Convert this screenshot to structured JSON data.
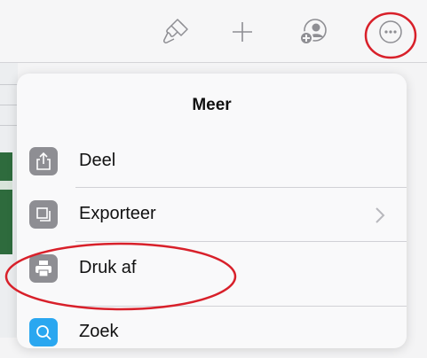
{
  "toolbar": {
    "icons": [
      "paintbrush-icon",
      "plus-icon",
      "add-collaborator-icon",
      "more-icon"
    ]
  },
  "popover": {
    "title": "Meer",
    "items": [
      {
        "label": "Deel",
        "icon": "share-icon"
      },
      {
        "label": "Exporteer",
        "icon": "export-icon",
        "has_chevron": true
      },
      {
        "label": "Druk af",
        "icon": "printer-icon"
      },
      {
        "label": "Zoek",
        "icon": "search-icon"
      }
    ]
  },
  "colors": {
    "annotation": "#d8202a",
    "icon_gray": "#8e8e93",
    "search_icon_blue": "#2aa7f0"
  }
}
